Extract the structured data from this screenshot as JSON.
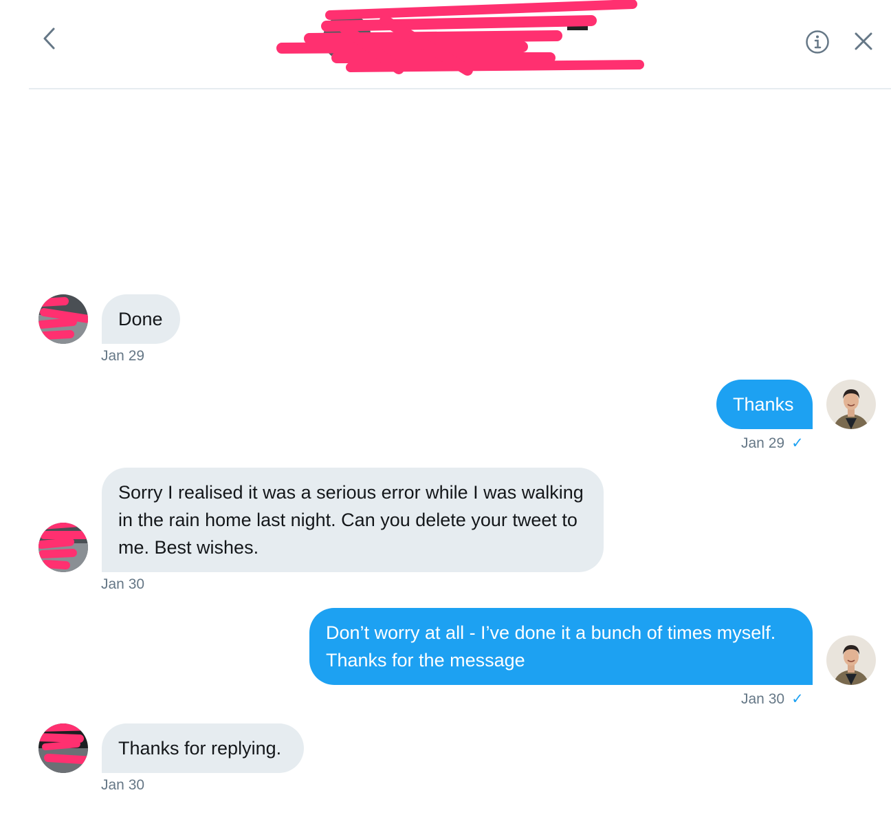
{
  "colors": {
    "sent_bubble": "#1da1f2",
    "received_bubble": "#e6ecf0",
    "timestamp": "#657786",
    "redaction": "#ff3070"
  },
  "header": {
    "back_icon": "chevron-left-icon",
    "info_icon": "info-icon",
    "close_icon": "close-icon"
  },
  "messages": [
    {
      "direction": "received",
      "text": "Done",
      "time": "Jan 29"
    },
    {
      "direction": "sent",
      "text": "Thanks",
      "time": "Jan 29",
      "status": "✓"
    },
    {
      "direction": "received",
      "text": "Sorry I realised it was a serious error while I was walking in the rain home last night. Can you delete your tweet to me. Best wishes.",
      "time": "Jan 30"
    },
    {
      "direction": "sent",
      "text": "Don’t worry at all - I’ve done it a bunch of times myself. Thanks for the message",
      "time": "Jan 30",
      "status": "✓"
    },
    {
      "direction": "received",
      "text": "Thanks for replying.",
      "time": "Jan 30"
    }
  ]
}
